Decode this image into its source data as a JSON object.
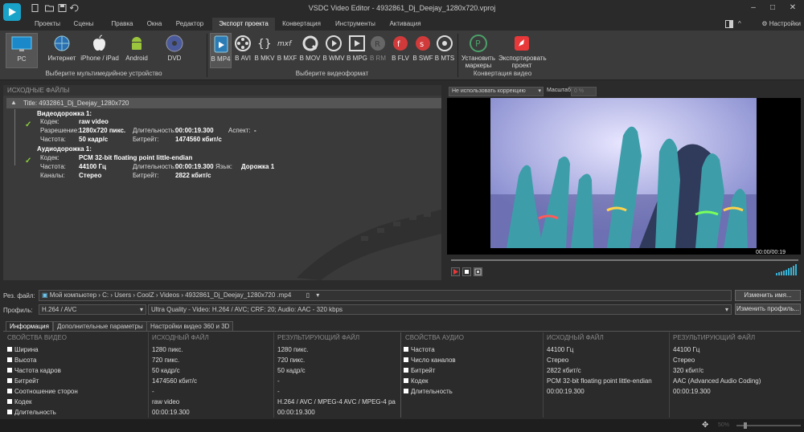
{
  "window": {
    "title": "VSDC Video Editor - 4932861_Dj_Deejay_1280x720.vproj"
  },
  "menu": {
    "items": [
      "Проекты",
      "Сцены",
      "Правка",
      "Окна",
      "Редактор",
      "Экспорт проекта",
      "Конвертация",
      "Инструменты",
      "Активация"
    ],
    "active": "Экспорт проекта",
    "settings": "Настройки"
  },
  "ribbon": {
    "devices": [
      "PC",
      "Интернет",
      "iPhone / iPad",
      "Android",
      "DVD"
    ],
    "devices_group": "Выберите мультимедийное устройство",
    "formats": [
      "В MP4",
      "В AVI",
      "В MKV",
      "В MXF",
      "В MOV",
      "В WMV",
      "В MPG",
      "В RM",
      "В FLV",
      "В SWF",
      "В MTS"
    ],
    "formats_group": "Выберите видеоформат",
    "set_markers": "Установить маркеры",
    "export_project": "Экспортировать проект",
    "export_group": "Конвертация видео"
  },
  "source": {
    "header": "ИСХОДНЫЕ ФАЙЛЫ",
    "title": "Title: 4932861_Dj_Deejay_1280x720",
    "video_track": "Видеодорожка 1:",
    "audio_track": "Аудиодорожка 1:",
    "labels": {
      "codec": "Кодек:",
      "resolution": "Разрешение:",
      "duration": "Длительность:",
      "aspect": "Аспект:",
      "fps": "Частота:",
      "bitrate": "Битрейт:",
      "freq": "Частота:",
      "lang": "Язык:",
      "channels": "Каналы:"
    },
    "video": {
      "codec": "raw video",
      "resolution": "1280x720 пикс.",
      "duration": "00:00:19.300",
      "aspect": "-",
      "fps": "50 кадр/с",
      "bitrate": "1474560 кбит/с"
    },
    "audio": {
      "codec": "PCM 32-bit floating point little-endian",
      "freq": "44100 Гц",
      "duration": "00:00:19.300",
      "lang": "Дорожка 1",
      "channels": "Стерео",
      "bitrate": "2822 кбит/с"
    }
  },
  "preview": {
    "correction": "Не использовать коррекцию",
    "zoom_label": "Масштаб:",
    "zoom_value": "0 %",
    "time": "00:00/00:19"
  },
  "output": {
    "file_label": "Рез. файл:",
    "path": [
      "Мой компьютер",
      "C:",
      "Users",
      "CoolZ",
      "Videos",
      "4932861_Dj_Deejay_1280x720",
      ".mp4"
    ],
    "rename": "Изменить имя...",
    "profile_label": "Профиль:",
    "profile": "H.264 / AVC",
    "quality": "Ultra Quality - Video: H.264 / AVC; CRF: 20; Audio: AAC - 320 kbps",
    "change_profile": "Изменить профиль..."
  },
  "tabs": [
    "Информация",
    "Дополнительные параметры",
    "Настройки видео 360 и 3D"
  ],
  "info": {
    "video_headers": [
      "СВОЙСТВА ВИДЕО",
      "ИСХОДНЫЙ ФАЙЛ",
      "РЕЗУЛЬТИРУЮЩИЙ ФАЙЛ"
    ],
    "video_rows": [
      [
        "Ширина",
        "1280 пикс.",
        "1280 пикс."
      ],
      [
        "Высота",
        "720 пикс.",
        "720 пикс."
      ],
      [
        "Частота кадров",
        "50 кадр/с",
        "50 кадр/с"
      ],
      [
        "Битрейт",
        "1474560 кбит/с",
        "-"
      ],
      [
        "Соотношение сторон",
        "-",
        "-"
      ],
      [
        "Кодек",
        "raw video",
        "H.264 / AVC / MPEG-4 AVC / MPEG-4 pa"
      ],
      [
        "Длительность",
        "00:00:19.300",
        "00:00:19.300"
      ]
    ],
    "audio_headers": [
      "СВОЙСТВА АУДИО",
      "ИСХОДНЫЙ ФАЙЛ",
      "РЕЗУЛЬТИРУЮЩИЙ ФАЙЛ"
    ],
    "audio_rows": [
      [
        "Частота",
        "44100 Гц",
        "44100 Гц"
      ],
      [
        "Число каналов",
        "Стерео",
        "Стерео"
      ],
      [
        "Битрейт",
        "2822 кбит/с",
        "320 кбит/с"
      ],
      [
        "Кодек",
        "PCM 32-bit floating point little-endian",
        "AAC (Advanced Audio Coding)"
      ],
      [
        "Длительность",
        "00:00:19.300",
        "00:00:19.300"
      ]
    ]
  },
  "status": {
    "zoom": "50%"
  },
  "colors": {
    "accent": "#1aa3c9",
    "check": "#8ccf3a",
    "export_red": "#e8383a"
  }
}
